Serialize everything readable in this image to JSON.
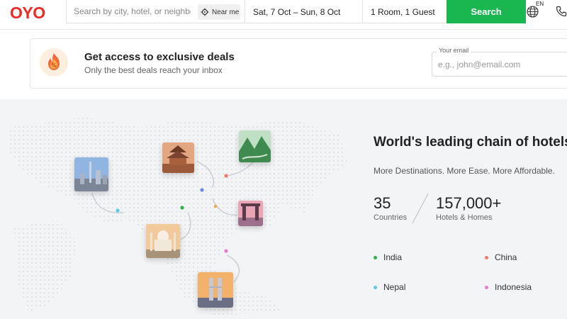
{
  "header": {
    "logo": "OYO",
    "search_placeholder": "Search by city, hotel, or neighborhood",
    "near_me_label": "Near me",
    "dates": "Sat, 7 Oct – Sun, 8 Oct",
    "guests": "1 Room, 1 Guest",
    "search_button": "Search",
    "language": "EN"
  },
  "deals": {
    "title": "Get access to exclusive deals",
    "subtitle": "Only the best deals reach your inbox",
    "email_label": "Your email",
    "email_placeholder": "e.g., john@email.com"
  },
  "destinations": {
    "title": "World's leading chain of hotels",
    "subtitle": "More Destinations. More Ease. More Affordable.",
    "stats": [
      {
        "value": "35",
        "label": "Countries"
      },
      {
        "value": "157,000+",
        "label": "Hotels & Homes"
      }
    ],
    "countries": [
      {
        "name": "India",
        "color": "#2db34a"
      },
      {
        "name": "China",
        "color": "#f07b6f"
      },
      {
        "name": "Nepal",
        "color": "#5ec8e5"
      },
      {
        "name": "Indonesia",
        "color": "#e67ad0"
      }
    ]
  },
  "colors": {
    "brand_red": "#ee2a24",
    "search_green": "#1ab64f"
  },
  "icons": [
    "near-me-icon",
    "globe-icon",
    "phone-icon",
    "fire-discount-icon"
  ]
}
